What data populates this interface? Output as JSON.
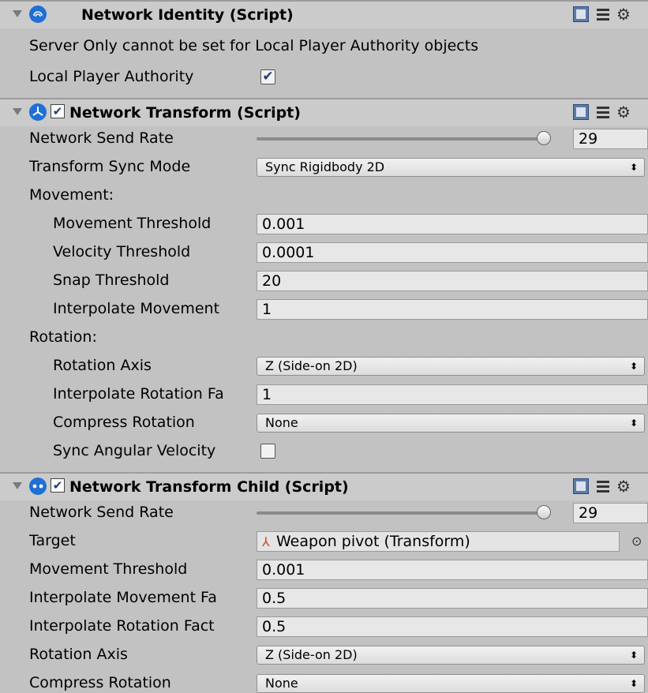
{
  "network_identity": {
    "title": "Network Identity (Script)",
    "icon": "fingerprint-icon",
    "message": "Server Only cannot be set for Local Player Authority objects",
    "local_player_authority_label": "Local Player Authority",
    "local_player_authority_checked": "✔"
  },
  "network_transform": {
    "title": "Network Transform (Script)",
    "enabled_mark": "✔",
    "send_rate_label": "Network Send Rate",
    "send_rate_value": "29",
    "sync_mode_label": "Transform Sync Mode",
    "sync_mode_value": "Sync Rigidbody 2D",
    "movement_header": "Movement:",
    "movement_threshold_label": "Movement Threshold",
    "movement_threshold_value": "0.001",
    "velocity_threshold_label": "Velocity Threshold",
    "velocity_threshold_value": "0.0001",
    "snap_threshold_label": "Snap Threshold",
    "snap_threshold_value": "20",
    "interpolate_movement_label": "Interpolate Movement",
    "interpolate_movement_value": "1",
    "rotation_header": "Rotation:",
    "rotation_axis_label": "Rotation Axis",
    "rotation_axis_value": "Z (Side-on 2D)",
    "interpolate_rotation_label": "Interpolate Rotation Fa",
    "interpolate_rotation_value": "1",
    "compress_rotation_label": "Compress Rotation",
    "compress_rotation_value": "None",
    "sync_angular_velocity_label": "Sync Angular Velocity"
  },
  "network_transform_child": {
    "title": "Network Transform Child (Script)",
    "enabled_mark": "✔",
    "send_rate_label": "Network Send Rate",
    "send_rate_value": "29",
    "target_label": "Target",
    "target_value": "Weapon pivot (Transform)",
    "movement_threshold_label": "Movement Threshold",
    "movement_threshold_value": "0.001",
    "interpolate_movement_label": "Interpolate Movement Fa",
    "interpolate_movement_value": "0.5",
    "interpolate_rotation_label": "Interpolate Rotation Fact",
    "interpolate_rotation_value": "0.5",
    "rotation_axis_label": "Rotation Axis",
    "rotation_axis_value": "Z (Side-on 2D)",
    "compress_rotation_label": "Compress Rotation",
    "compress_rotation_value": "None"
  },
  "icons": {
    "dropdown_arrow": "⬍",
    "gear": "⚙",
    "picker": "⊙",
    "transform": "⅄"
  },
  "colors": {
    "panel_bg": "#c2c2c2",
    "header_bg": "#cbcbcb",
    "icon_blue": "#1f6fd6",
    "checkmark": "#1e3c78"
  }
}
